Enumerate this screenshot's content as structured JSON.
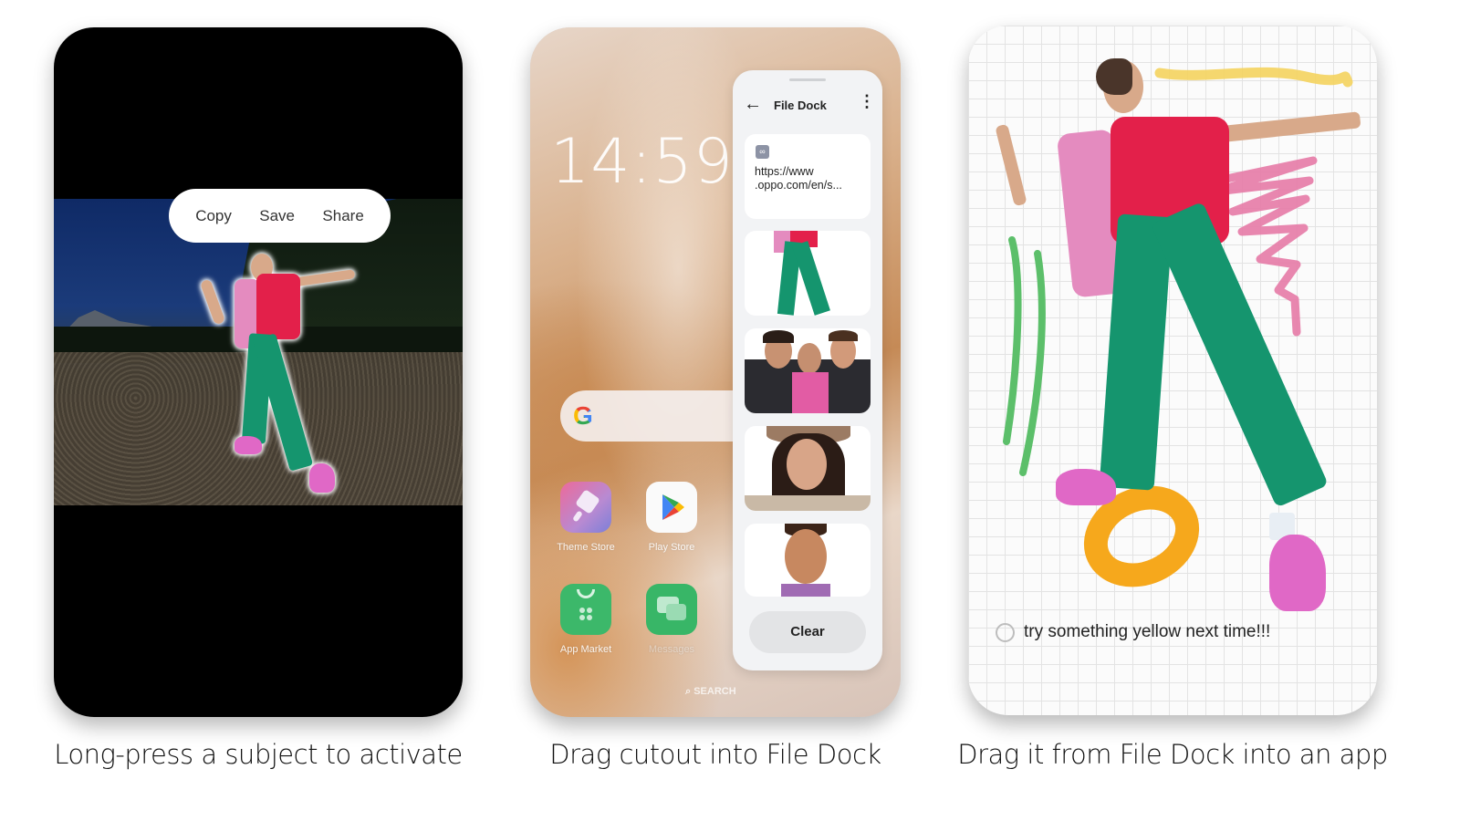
{
  "panels": [
    {
      "id": "long-press",
      "caption": "Long-press a subject to activate",
      "context_menu": {
        "items": [
          {
            "label": "Copy",
            "icon": "copy-action"
          },
          {
            "label": "Save",
            "icon": "save-action"
          },
          {
            "label": "Share",
            "icon": "share-action"
          }
        ]
      }
    },
    {
      "id": "file-dock",
      "caption": "Drag cutout into File Dock",
      "home_screen": {
        "clock": "14:59",
        "search_bar_icon": "google-g-icon",
        "apps": [
          {
            "label": "Theme Store",
            "icon": "theme-store-icon"
          },
          {
            "label": "Play Store",
            "icon": "play-store-icon"
          },
          {
            "label": "App Market",
            "icon": "app-market-icon"
          },
          {
            "label": "Messages",
            "icon": "messages-icon"
          }
        ],
        "dock_search_label": "SEARCH"
      },
      "file_dock": {
        "title": "File Dock",
        "back_icon": "arrow-left-icon",
        "more_icon": "more-vertical-icon",
        "link_item": {
          "icon": "link-icon",
          "text_line1": "https://www",
          "text_line2": ".oppo.com/en/s..."
        },
        "image_items": [
          {
            "description": "cutout legs green pants"
          },
          {
            "description": "group of three friends"
          },
          {
            "description": "woman with hat"
          },
          {
            "description": "smiling man"
          }
        ],
        "clear_label": "Clear"
      }
    },
    {
      "id": "into-app",
      "caption": "Drag it from File Dock into an app",
      "note": {
        "checkbox_checked": false,
        "text": "try something yellow next time!!!"
      },
      "doodle_colors": {
        "yellow": "#f4d35e",
        "pink": "#e57aa6",
        "green": "#5cbf6a",
        "orange": "#f6a81c"
      }
    }
  ],
  "colors": {
    "pants_green": "#15956e",
    "shirt_red": "#e3204a",
    "shirt_pink": "#e48bbf",
    "shoes_pink": "#e068c6"
  }
}
